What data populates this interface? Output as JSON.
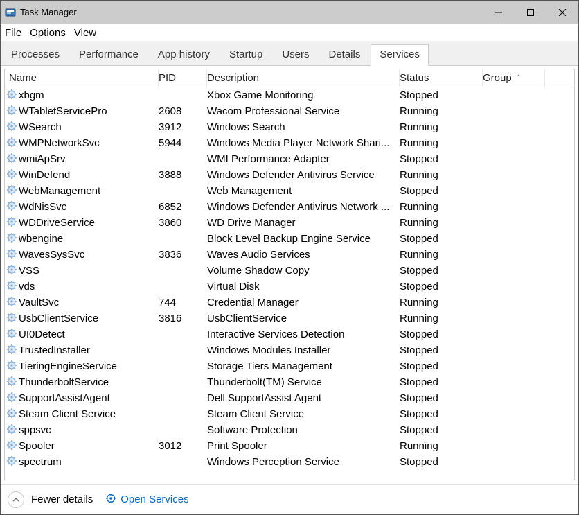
{
  "window": {
    "title": "Task Manager"
  },
  "menu": {
    "file": "File",
    "options": "Options",
    "view": "View"
  },
  "title_controls": {
    "min": "–",
    "max": "▢",
    "close": "✕"
  },
  "tabs": {
    "processes": "Processes",
    "performance": "Performance",
    "app_history": "App history",
    "startup": "Startup",
    "users": "Users",
    "details": "Details",
    "services": "Services"
  },
  "columns": {
    "name": "Name",
    "pid": "PID",
    "description": "Description",
    "status": "Status",
    "group": "Group"
  },
  "sort_indicator": "⌃",
  "footer": {
    "fewer_arrow": "⌃",
    "fewer": "Fewer details",
    "open_services": "Open Services"
  },
  "rows": [
    {
      "name": "xbgm",
      "pid": "",
      "desc": "Xbox Game Monitoring",
      "status": "Stopped"
    },
    {
      "name": "WTabletServicePro",
      "pid": "2608",
      "desc": "Wacom Professional Service",
      "status": "Running"
    },
    {
      "name": "WSearch",
      "pid": "3912",
      "desc": "Windows Search",
      "status": "Running"
    },
    {
      "name": "WMPNetworkSvc",
      "pid": "5944",
      "desc": "Windows Media Player Network Shari...",
      "status": "Running"
    },
    {
      "name": "wmiApSrv",
      "pid": "",
      "desc": "WMI Performance Adapter",
      "status": "Stopped"
    },
    {
      "name": "WinDefend",
      "pid": "3888",
      "desc": "Windows Defender Antivirus Service",
      "status": "Running"
    },
    {
      "name": "WebManagement",
      "pid": "",
      "desc": "Web Management",
      "status": "Stopped"
    },
    {
      "name": "WdNisSvc",
      "pid": "6852",
      "desc": "Windows Defender Antivirus Network ...",
      "status": "Running"
    },
    {
      "name": "WDDriveService",
      "pid": "3860",
      "desc": "WD Drive Manager",
      "status": "Running"
    },
    {
      "name": "wbengine",
      "pid": "",
      "desc": "Block Level Backup Engine Service",
      "status": "Stopped"
    },
    {
      "name": "WavesSysSvc",
      "pid": "3836",
      "desc": "Waves Audio Services",
      "status": "Running"
    },
    {
      "name": "VSS",
      "pid": "",
      "desc": "Volume Shadow Copy",
      "status": "Stopped"
    },
    {
      "name": "vds",
      "pid": "",
      "desc": "Virtual Disk",
      "status": "Stopped"
    },
    {
      "name": "VaultSvc",
      "pid": "744",
      "desc": "Credential Manager",
      "status": "Running"
    },
    {
      "name": "UsbClientService",
      "pid": "3816",
      "desc": "UsbClientService",
      "status": "Running"
    },
    {
      "name": "UI0Detect",
      "pid": "",
      "desc": "Interactive Services Detection",
      "status": "Stopped"
    },
    {
      "name": "TrustedInstaller",
      "pid": "",
      "desc": "Windows Modules Installer",
      "status": "Stopped"
    },
    {
      "name": "TieringEngineService",
      "pid": "",
      "desc": "Storage Tiers Management",
      "status": "Stopped"
    },
    {
      "name": "ThunderboltService",
      "pid": "",
      "desc": "Thunderbolt(TM) Service",
      "status": "Stopped"
    },
    {
      "name": "SupportAssistAgent",
      "pid": "",
      "desc": "Dell SupportAssist Agent",
      "status": "Stopped"
    },
    {
      "name": "Steam Client Service",
      "pid": "",
      "desc": "Steam Client Service",
      "status": "Stopped"
    },
    {
      "name": "sppsvc",
      "pid": "",
      "desc": "Software Protection",
      "status": "Stopped"
    },
    {
      "name": "Spooler",
      "pid": "3012",
      "desc": "Print Spooler",
      "status": "Running"
    },
    {
      "name": "spectrum",
      "pid": "",
      "desc": "Windows Perception Service",
      "status": "Stopped"
    }
  ]
}
